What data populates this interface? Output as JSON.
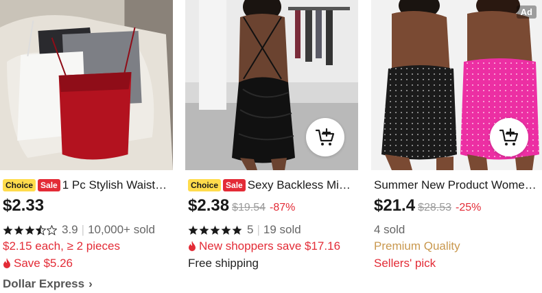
{
  "colors": {
    "accent_red": "#e32b36",
    "choice_yellow": "#ffdc4c",
    "premium_gold": "#c9984e"
  },
  "products": [
    {
      "choice_badge": "Choice",
      "sale_badge": "Sale",
      "title": "1 Pc Stylish Waist…",
      "price": "$2.33",
      "rating_value": "3.9",
      "stars_filled": 3.5,
      "sold": "10,000+ sold",
      "bulk_offer": "$2.15 each, ≥ 2 pieces",
      "save": "Save $5.26",
      "store": "Dollar Express",
      "store_chevron": "›"
    },
    {
      "choice_badge": "Choice",
      "sale_badge": "Sale",
      "title": "Sexy Backless Mi…",
      "price": "$2.38",
      "old_price": "$19.54",
      "discount": "-87%",
      "rating_value": "5",
      "stars_filled": 5,
      "sold": "19 sold",
      "promo": "New shoppers save $17.16",
      "shipping": "Free shipping",
      "cart_icon": "add-to-cart-icon"
    },
    {
      "title": "Summer New Product Wome…",
      "price": "$21.4",
      "old_price": "$28.53",
      "discount": "-25%",
      "sold": "4 sold",
      "quality": "Premium Quality",
      "pick": "Sellers' pick",
      "ad_label": "Ad",
      "cart_icon": "add-to-cart-icon"
    }
  ]
}
